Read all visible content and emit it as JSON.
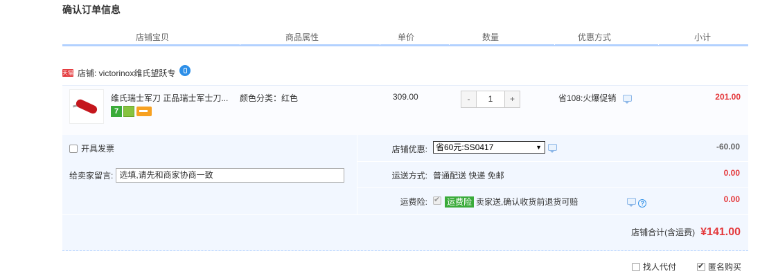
{
  "title": "确认订单信息",
  "columns": [
    "店铺宝贝",
    "商品属性",
    "单价",
    "数量",
    "优惠方式",
    "小计"
  ],
  "shop": {
    "badge": "天猫",
    "label": "店铺: victorinox维氏望跃专"
  },
  "item": {
    "title": "维氏瑞士军刀 正品瑞士军士刀...",
    "badge_7": "7",
    "attribute": "颜色分类：红色",
    "price": "309.00",
    "qty_minus": "-",
    "qty_value": "1",
    "qty_plus": "+",
    "promo": "省108:火爆促销",
    "subtotal": "201.00"
  },
  "invoice": {
    "label": "开具发票",
    "checked": false
  },
  "memo": {
    "label": "给卖家留言:",
    "value": "选填,请先和商家协商一致"
  },
  "shop_discount": {
    "label": "店铺优惠:",
    "selected": "省60元:SS0417",
    "amount": "-60.00"
  },
  "shipping": {
    "label": "运送方式:",
    "value": "普通配送 快递 免邮",
    "amount": "0.00"
  },
  "insurance": {
    "label": "运费险:",
    "tag": "运费险",
    "text": "卖家送,确认收货前退货可赔",
    "amount": "0.00",
    "checked": true
  },
  "total": {
    "label": "店铺合计(含运费)",
    "value": "¥141.00"
  },
  "footer": {
    "proxy_pay": "找人代付",
    "proxy_checked": false,
    "anonymous": "匿名购买",
    "anonymous_checked": true
  },
  "colors": {
    "accent": "#e4393c",
    "panel": "#f2f7ff",
    "header_line": "#b2d1ff"
  }
}
